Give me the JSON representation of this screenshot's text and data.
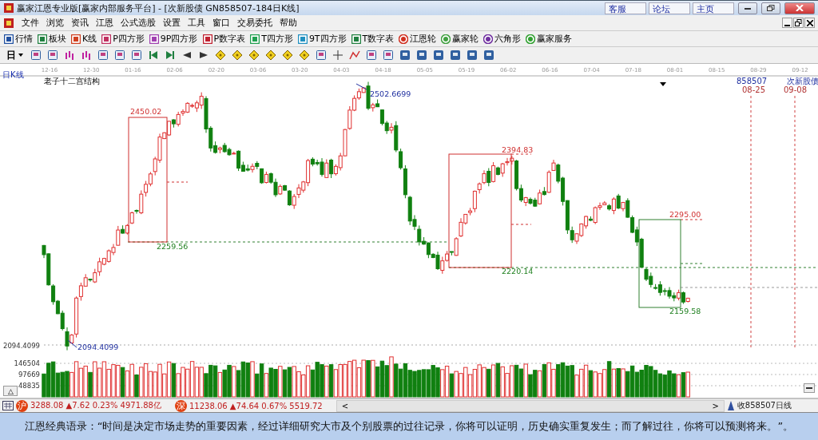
{
  "window": {
    "title": "赢家江恩专业版[赢家内部服务平台] - [次新股债  GN858507-184日K线]",
    "links": [
      "客服",
      "论坛",
      "主页"
    ]
  },
  "menu": [
    "文件",
    "浏览",
    "资讯",
    "江恩",
    "公式选股",
    "设置",
    "工具",
    "窗口",
    "交易委托",
    "帮助"
  ],
  "toolbar": [
    "行情",
    "板块",
    "K线",
    "P四方形",
    "9P四方形",
    "P数字表",
    "T四方形",
    "9T四方形",
    "T数字表",
    "江恩轮",
    "赢家轮",
    "六角形",
    "赢家服务"
  ],
  "toolbar2": {
    "period": "日"
  },
  "chart": {
    "period_label": "日K线",
    "study_title": "老子十二宫结构",
    "dates": [
      "12-16",
      "12-30",
      "01-16",
      "02-06",
      "02-20",
      "03-06",
      "03-20",
      "04-03",
      "04-18",
      "05-05",
      "05-19",
      "06-02",
      "06-16",
      "07-04",
      "07-18",
      "08-01",
      "08-15",
      "08-29",
      "09-12"
    ],
    "code_label": "858507",
    "name_label": "次新股债",
    "future_dates": [
      "08-25",
      "09-08"
    ],
    "annotations": [
      {
        "text": "2450.02",
        "kind": "high"
      },
      {
        "text": "2502.6699",
        "kind": "extreme"
      },
      {
        "text": "2394.83",
        "kind": "high"
      },
      {
        "text": "2295.00",
        "kind": "high"
      },
      {
        "text": "2259.56",
        "kind": "low"
      },
      {
        "text": "2220.14",
        "kind": "low"
      },
      {
        "text": "2159.58",
        "kind": "low"
      },
      {
        "text": "2094.4099",
        "kind": "extreme"
      }
    ],
    "price_axis": "2094.4099",
    "volume_axis": [
      "146504",
      "97669",
      "48835"
    ],
    "collapse_button": "△"
  },
  "status_bar": {
    "quotes": [
      {
        "badge": "沪",
        "text": "3288.08 ▲7.62 0.23% 4971.88亿"
      },
      {
        "badge": "深",
        "text": "11238.06 ▲74.64 0.67% 5519.72"
      }
    ],
    "scroll_left": "<",
    "scroll_right": ">",
    "right_text": "收858507日线"
  },
  "quote_bar": "江恩经典语录：“时间是决定市场走势的重要因素，经过详细研究大市及个别股票的过往记录，你将可以证明，历史确实重复发生；而了解过往，你将可以预测将来。”。"
}
